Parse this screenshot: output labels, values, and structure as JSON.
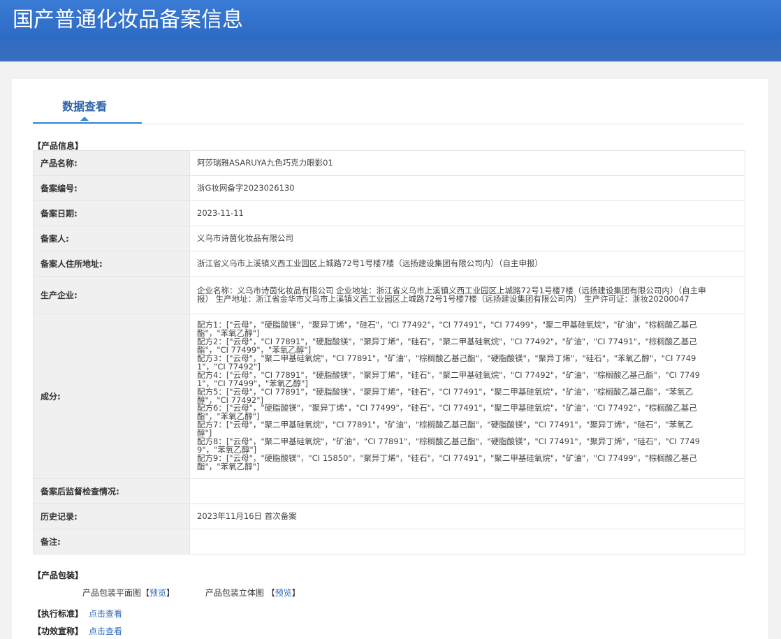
{
  "header": {
    "title": "国产普通化妆品备案信息"
  },
  "tab": {
    "label": "数据查看"
  },
  "product_info": {
    "section_title": "【产品信息】",
    "rows": [
      {
        "label": "产品名称:",
        "value": "阿莎瑞雅ASARUYA九色巧克力眼影01"
      },
      {
        "label": "备案编号:",
        "value": "浙G妆网备字2023026130"
      },
      {
        "label": "备案日期:",
        "value": "2023-11-11"
      },
      {
        "label": "备案人:",
        "value": "义乌市诗茵化妆品有限公司"
      },
      {
        "label": "备案人住所地址:",
        "value": "浙江省义乌市上溪镇义西工业园区上城路72号1号楼7楼（远扬建设集团有限公司内）（自主申报）"
      },
      {
        "label": "生产企业:",
        "value": "企业名称：义乌市诗茵化妆品有限公司 企业地址：浙江省义乌市上溪镇义西工业园区上城路72号1号楼7楼（远扬建设集团有限公司内）（自主申报） 生产地址：浙江省金华市义乌市上溪镇义西工业园区上城路72号1号楼7楼（远扬建设集团有限公司内） 生产许可证：浙妆20200047"
      },
      {
        "label": "成分:",
        "lines": [
          "配方1：[\"云母\"，\"硬脂酸镁\"，\"聚异丁烯\"，\"硅石\"，\"CI 77492\"，\"CI 77491\"，\"CI 77499\"，\"聚二甲基硅氧烷\"，\"矿油\"，\"棕榈酸乙基己酯\"，\"苯氧乙醇\"]",
          "配方2：[\"云母\"，\"CI 77891\"，\"硬脂酸镁\"，\"聚异丁烯\"，\"硅石\"，\"聚二甲基硅氧烷\"，\"CI 77492\"，\"矿油\"，\"CI 77491\"，\"棕榈酸乙基己酯\"，\"CI 77499\"，\"苯氧乙醇\"]",
          "配方3：[\"云母\"，\"聚二甲基硅氧烷\"，\"CI 77891\"，\"矿油\"，\"棕榈酸乙基己酯\"，\"硬脂酸镁\"，\"聚异丁烯\"，\"硅石\"，\"苯氧乙醇\"，\"CI 77491\"，\"CI 77492\"]",
          "配方4：[\"云母\"，\"CI 77891\"，\"硬脂酸镁\"，\"聚异丁烯\"，\"硅石\"，\"聚二甲基硅氧烷\"，\"CI 77492\"，\"矿油\"，\"棕榈酸乙基己酯\"，\"CI 77491\"，\"CI 77499\"，\"苯氧乙醇\"]",
          "配方5：[\"云母\"，\"CI 77891\"，\"硬脂酸镁\"，\"聚异丁烯\"，\"硅石\"，\"CI 77491\"，\"聚二甲基硅氧烷\"，\"矿油\"，\"棕榈酸乙基己酯\"，\"苯氧乙醇\"，\"CI 77492\"]",
          "配方6：[\"云母\"，\"硬脂酸镁\"，\"聚异丁烯\"，\"CI 77499\"，\"硅石\"，\"CI 77491\"，\"聚二甲基硅氧烷\"，\"矿油\"，\"CI 77492\"，\"棕榈酸乙基己酯\"，\"苯氧乙醇\"]",
          "配方7：[\"云母\"，\"聚二甲基硅氧烷\"，\"CI 77891\"，\"矿油\"，\"棕榈酸乙基己酯\"，\"硬脂酸镁\"，\"CI 77491\"，\"聚异丁烯\"，\"硅石\"，\"苯氧乙醇\"]",
          "配方8：[\"云母\"，\"聚二甲基硅氧烷\"，\"矿油\"，\"CI 77891\"，\"棕榈酸乙基己酯\"，\"硬脂酸镁\"，\"CI 77491\"，\"聚异丁烯\"，\"硅石\"，\"CI 77499\"，\"苯氧乙醇\"]",
          "配方9：[\"云母\"，\"硬脂酸镁\"，\"CI 15850\"，\"聚异丁烯\"，\"硅石\"，\"CI 77491\"，\"聚二甲基硅氧烷\"，\"矿油\"，\"CI 77499\"，\"棕榈酸乙基己酯\"，\"苯氧乙醇\"]"
        ]
      },
      {
        "label": "备案后监督检查情况:",
        "value": ""
      },
      {
        "label": "历史记录:",
        "value": "2023年11月16日 首次备案"
      },
      {
        "label": "备注:",
        "value": ""
      }
    ]
  },
  "packaging": {
    "section_title": "【产品包装】",
    "flat_label": "产品包装平面图",
    "solid_label": "产品包装立体图",
    "preview_link": "预览",
    "bracket_open": "【",
    "bracket_close": "】"
  },
  "standard": {
    "section_title": "【执行标准】",
    "link": "点击查看"
  },
  "efficacy": {
    "section_title": "【功效宣称】",
    "link": "点击查看"
  },
  "colors": {
    "header_bg": "#2e6bc4",
    "tab_accent": "#3a86d1",
    "link": "#2e6bb8",
    "table_border": "#9fc1e5",
    "label_bg": "#f0f0f0"
  }
}
